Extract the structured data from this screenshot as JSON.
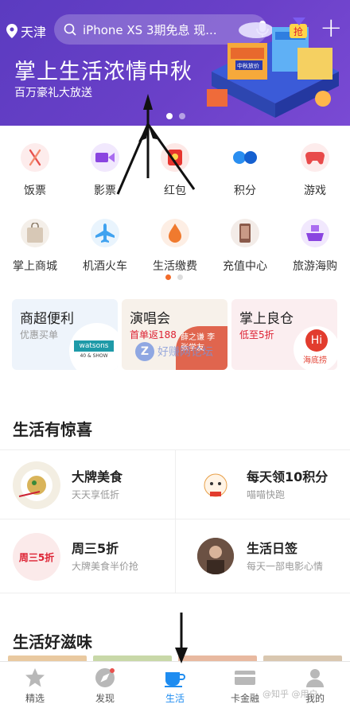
{
  "header": {
    "location": "天津",
    "search_text": "iPhone XS 3期免息 现...",
    "add_symbol": "+"
  },
  "banner": {
    "title": "掌上生活浓情中秋",
    "subtitle": "百万豪礼大放送",
    "art_text": {
      "left_tag": "中秋放价",
      "badge": "抢"
    },
    "bg_color": "#6a40c8"
  },
  "menu": [
    {
      "label": "饭票",
      "icon": "fork-knife-icon",
      "color": "#e8514d"
    },
    {
      "label": "影票",
      "icon": "movie-camera-icon",
      "color": "#8a45e0"
    },
    {
      "label": "红包",
      "icon": "red-packet-icon",
      "color": "#e7352f"
    },
    {
      "label": "积分",
      "icon": "points-icon",
      "color": "#2a8ef0"
    },
    {
      "label": "游戏",
      "icon": "gamepad-icon",
      "color": "#e84a4a"
    },
    {
      "label": "掌上商城",
      "icon": "shopping-bag-icon",
      "color": "#c9b8a4"
    },
    {
      "label": "机酒火车",
      "icon": "airplane-icon",
      "color": "#3fa2f0"
    },
    {
      "label": "生活缴费",
      "icon": "water-drop-icon",
      "color": "#f07a2e"
    },
    {
      "label": "充值中心",
      "icon": "phone-icon",
      "color": "#8a5a4a"
    },
    {
      "label": "旅游海购",
      "icon": "cruise-ship-icon",
      "color": "#8a45e0"
    }
  ],
  "promo_cards": [
    {
      "title": "商超便利",
      "subtitle": "优惠买单",
      "logo_text": "watsons",
      "logo_sub": "40 & SHOW",
      "bg": "#eef4fb"
    },
    {
      "title": "演唱会",
      "subtitle": "首单返188",
      "logo_text": "薛之谦 李 张学友",
      "bg": "#f7f1ea"
    },
    {
      "title": "掌上良仓",
      "subtitle": "低至5折",
      "logo_text": "海底捞",
      "bg": "#fbeef0"
    }
  ],
  "watermark": "好赚网论坛",
  "surprise": {
    "title": "生活有惊喜",
    "items": [
      {
        "title": "大牌美食",
        "subtitle": "天天享低折"
      },
      {
        "title": "每天领10积分",
        "subtitle": "喵喵快跑"
      },
      {
        "title": "周三5折",
        "subtitle": "大牌美食半价抢",
        "icon_text": "周三5折"
      },
      {
        "title": "生活日签",
        "subtitle": "每天一部电影心情"
      }
    ]
  },
  "flavor": {
    "title": "生活好滋味"
  },
  "tabs": [
    {
      "label": "精选",
      "icon": "star-icon"
    },
    {
      "label": "发现",
      "icon": "compass-icon"
    },
    {
      "label": "生活",
      "icon": "coffee-cup-icon"
    },
    {
      "label": "卡金融",
      "icon": "credit-card-icon"
    },
    {
      "label": "我的",
      "icon": "user-icon"
    }
  ],
  "weibo_watermark": "@知乎 @用户"
}
